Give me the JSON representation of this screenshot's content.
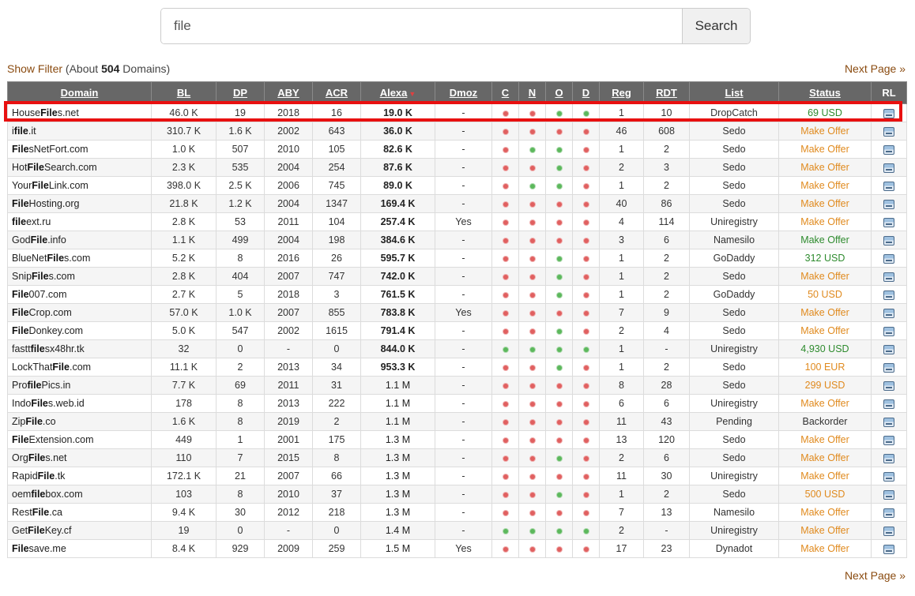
{
  "search": {
    "query": "file",
    "button_label": "Search"
  },
  "filter": {
    "show_filter_label": "Show Filter",
    "about_prefix": " (About ",
    "count": "504",
    "about_suffix": " Domains)"
  },
  "pagination": {
    "next_label": "Next Page »"
  },
  "table": {
    "headers": [
      "Domain",
      "BL",
      "DP",
      "ABY",
      "ACR",
      "Alexa",
      "Dmoz",
      "C",
      "N",
      "O",
      "D",
      "Reg",
      "RDT",
      "List",
      "Status",
      "RL"
    ],
    "sort_indicator": "▼",
    "rows": [
      {
        "pre": "House",
        "kw": "File",
        "post": "s.net",
        "bl": "46.0 K",
        "dp": "19",
        "aby": "2018",
        "acr": "16",
        "alexa": "19.0 K",
        "dmoz": "-",
        "c": "red",
        "n": "red",
        "o": "green",
        "d": "green",
        "reg": "1",
        "rdt": "10",
        "list": "DropCatch",
        "status": "69 USD",
        "status_color": "green"
      },
      {
        "pre": "i",
        "kw": "file",
        "post": ".it",
        "bl": "310.7 K",
        "dp": "1.6 K",
        "aby": "2002",
        "acr": "643",
        "alexa": "36.0 K",
        "dmoz": "-",
        "c": "red",
        "n": "red",
        "o": "red",
        "d": "red",
        "reg": "46",
        "rdt": "608",
        "list": "Sedo",
        "status": "Make Offer",
        "status_color": "orange"
      },
      {
        "pre": "",
        "kw": "File",
        "post": "sNetFort.com",
        "bl": "1.0 K",
        "dp": "507",
        "aby": "2010",
        "acr": "105",
        "alexa": "82.6 K",
        "dmoz": "-",
        "c": "red",
        "n": "green",
        "o": "green",
        "d": "red",
        "reg": "1",
        "rdt": "2",
        "list": "Sedo",
        "status": "Make Offer",
        "status_color": "orange"
      },
      {
        "pre": "Hot",
        "kw": "File",
        "post": "Search.com",
        "bl": "2.3 K",
        "dp": "535",
        "aby": "2004",
        "acr": "254",
        "alexa": "87.6 K",
        "dmoz": "-",
        "c": "red",
        "n": "red",
        "o": "green",
        "d": "red",
        "reg": "2",
        "rdt": "3",
        "list": "Sedo",
        "status": "Make Offer",
        "status_color": "orange"
      },
      {
        "pre": "Your",
        "kw": "File",
        "post": "Link.com",
        "bl": "398.0 K",
        "dp": "2.5 K",
        "aby": "2006",
        "acr": "745",
        "alexa": "89.0 K",
        "dmoz": "-",
        "c": "red",
        "n": "green",
        "o": "green",
        "d": "red",
        "reg": "1",
        "rdt": "2",
        "list": "Sedo",
        "status": "Make Offer",
        "status_color": "orange"
      },
      {
        "pre": "",
        "kw": "File",
        "post": "Hosting.org",
        "bl": "21.8 K",
        "dp": "1.2 K",
        "aby": "2004",
        "acr": "1347",
        "alexa": "169.4 K",
        "dmoz": "-",
        "c": "red",
        "n": "red",
        "o": "red",
        "d": "red",
        "reg": "40",
        "rdt": "86",
        "list": "Sedo",
        "status": "Make Offer",
        "status_color": "orange"
      },
      {
        "pre": "",
        "kw": "file",
        "post": "ext.ru",
        "bl": "2.8 K",
        "dp": "53",
        "aby": "2011",
        "acr": "104",
        "alexa": "257.4 K",
        "dmoz": "Yes",
        "c": "red",
        "n": "red",
        "o": "red",
        "d": "red",
        "reg": "4",
        "rdt": "114",
        "list": "Uniregistry",
        "status": "Make Offer",
        "status_color": "orange"
      },
      {
        "pre": "God",
        "kw": "File",
        "post": ".info",
        "bl": "1.1 K",
        "dp": "499",
        "aby": "2004",
        "acr": "198",
        "alexa": "384.6 K",
        "dmoz": "-",
        "c": "red",
        "n": "red",
        "o": "red",
        "d": "red",
        "reg": "3",
        "rdt": "6",
        "list": "Namesilo",
        "status": "Make Offer",
        "status_color": "green"
      },
      {
        "pre": "BlueNet",
        "kw": "File",
        "post": "s.com",
        "bl": "5.2 K",
        "dp": "8",
        "aby": "2016",
        "acr": "26",
        "alexa": "595.7 K",
        "dmoz": "-",
        "c": "red",
        "n": "red",
        "o": "green",
        "d": "red",
        "reg": "1",
        "rdt": "2",
        "list": "GoDaddy",
        "status": "312 USD",
        "status_color": "green"
      },
      {
        "pre": "Snip",
        "kw": "File",
        "post": "s.com",
        "bl": "2.8 K",
        "dp": "404",
        "aby": "2007",
        "acr": "747",
        "alexa": "742.0 K",
        "dmoz": "-",
        "c": "red",
        "n": "red",
        "o": "green",
        "d": "red",
        "reg": "1",
        "rdt": "2",
        "list": "Sedo",
        "status": "Make Offer",
        "status_color": "orange"
      },
      {
        "pre": "",
        "kw": "File",
        "post": "007.com",
        "bl": "2.7 K",
        "dp": "5",
        "aby": "2018",
        "acr": "3",
        "alexa": "761.5 K",
        "dmoz": "-",
        "c": "red",
        "n": "red",
        "o": "green",
        "d": "red",
        "reg": "1",
        "rdt": "2",
        "list": "GoDaddy",
        "status": "50 USD",
        "status_color": "orange"
      },
      {
        "pre": "",
        "kw": "File",
        "post": "Crop.com",
        "bl": "57.0 K",
        "dp": "1.0 K",
        "aby": "2007",
        "acr": "855",
        "alexa": "783.8 K",
        "dmoz": "Yes",
        "c": "red",
        "n": "red",
        "o": "red",
        "d": "red",
        "reg": "7",
        "rdt": "9",
        "list": "Sedo",
        "status": "Make Offer",
        "status_color": "orange"
      },
      {
        "pre": "",
        "kw": "File",
        "post": "Donkey.com",
        "bl": "5.0 K",
        "dp": "547",
        "aby": "2002",
        "acr": "1615",
        "alexa": "791.4 K",
        "dmoz": "-",
        "c": "red",
        "n": "red",
        "o": "green",
        "d": "red",
        "reg": "2",
        "rdt": "4",
        "list": "Sedo",
        "status": "Make Offer",
        "status_color": "orange"
      },
      {
        "pre": "fastt",
        "kw": "file",
        "post": "sx48hr.tk",
        "bl": "32",
        "dp": "0",
        "aby": "-",
        "acr": "0",
        "alexa": "844.0 K",
        "dmoz": "-",
        "c": "green",
        "n": "green",
        "o": "green",
        "d": "green",
        "reg": "1",
        "rdt": "-",
        "list": "Uniregistry",
        "status": "4,930 USD",
        "status_color": "green"
      },
      {
        "pre": "LockThat",
        "kw": "File",
        "post": ".com",
        "bl": "11.1 K",
        "dp": "2",
        "aby": "2013",
        "acr": "34",
        "alexa": "953.3 K",
        "dmoz": "-",
        "c": "red",
        "n": "red",
        "o": "green",
        "d": "red",
        "reg": "1",
        "rdt": "2",
        "list": "Sedo",
        "status": "100 EUR",
        "status_color": "orange"
      },
      {
        "pre": "Pro",
        "kw": "file",
        "post": "Pics.in",
        "bl": "7.7 K",
        "dp": "69",
        "aby": "2011",
        "acr": "31",
        "alexa": "1.1 M",
        "dmoz": "-",
        "c": "red",
        "n": "red",
        "o": "red",
        "d": "red",
        "reg": "8",
        "rdt": "28",
        "list": "Sedo",
        "status": "299 USD",
        "status_color": "orange"
      },
      {
        "pre": "Indo",
        "kw": "File",
        "post": "s.web.id",
        "bl": "178",
        "dp": "8",
        "aby": "2013",
        "acr": "222",
        "alexa": "1.1 M",
        "dmoz": "-",
        "c": "red",
        "n": "red",
        "o": "red",
        "d": "red",
        "reg": "6",
        "rdt": "6",
        "list": "Uniregistry",
        "status": "Make Offer",
        "status_color": "orange"
      },
      {
        "pre": "Zip",
        "kw": "File",
        "post": ".co",
        "bl": "1.6 K",
        "dp": "8",
        "aby": "2019",
        "acr": "2",
        "alexa": "1.1 M",
        "dmoz": "-",
        "c": "red",
        "n": "red",
        "o": "red",
        "d": "red",
        "reg": "11",
        "rdt": "43",
        "list": "Pending",
        "status": "Backorder",
        "status_color": "dark"
      },
      {
        "pre": "",
        "kw": "File",
        "post": "Extension.com",
        "bl": "449",
        "dp": "1",
        "aby": "2001",
        "acr": "175",
        "alexa": "1.3 M",
        "dmoz": "-",
        "c": "red",
        "n": "red",
        "o": "red",
        "d": "red",
        "reg": "13",
        "rdt": "120",
        "list": "Sedo",
        "status": "Make Offer",
        "status_color": "orange"
      },
      {
        "pre": "Org",
        "kw": "File",
        "post": "s.net",
        "bl": "110",
        "dp": "7",
        "aby": "2015",
        "acr": "8",
        "alexa": "1.3 M",
        "dmoz": "-",
        "c": "red",
        "n": "red",
        "o": "green",
        "d": "red",
        "reg": "2",
        "rdt": "6",
        "list": "Sedo",
        "status": "Make Offer",
        "status_color": "orange"
      },
      {
        "pre": "Rapid",
        "kw": "File",
        "post": ".tk",
        "bl": "172.1 K",
        "dp": "21",
        "aby": "2007",
        "acr": "66",
        "alexa": "1.3 M",
        "dmoz": "-",
        "c": "red",
        "n": "red",
        "o": "red",
        "d": "red",
        "reg": "11",
        "rdt": "30",
        "list": "Uniregistry",
        "status": "Make Offer",
        "status_color": "orange"
      },
      {
        "pre": "oem",
        "kw": "file",
        "post": "box.com",
        "bl": "103",
        "dp": "8",
        "aby": "2010",
        "acr": "37",
        "alexa": "1.3 M",
        "dmoz": "-",
        "c": "red",
        "n": "red",
        "o": "green",
        "d": "red",
        "reg": "1",
        "rdt": "2",
        "list": "Sedo",
        "status": "500 USD",
        "status_color": "orange"
      },
      {
        "pre": "Rest",
        "kw": "File",
        "post": ".ca",
        "bl": "9.4 K",
        "dp": "30",
        "aby": "2012",
        "acr": "218",
        "alexa": "1.3 M",
        "dmoz": "-",
        "c": "red",
        "n": "red",
        "o": "red",
        "d": "red",
        "reg": "7",
        "rdt": "13",
        "list": "Namesilo",
        "status": "Make Offer",
        "status_color": "orange"
      },
      {
        "pre": "Get",
        "kw": "File",
        "post": "Key.cf",
        "bl": "19",
        "dp": "0",
        "aby": "-",
        "acr": "0",
        "alexa": "1.4 M",
        "dmoz": "-",
        "c": "green",
        "n": "green",
        "o": "green",
        "d": "green",
        "reg": "2",
        "rdt": "-",
        "list": "Uniregistry",
        "status": "Make Offer",
        "status_color": "orange"
      },
      {
        "pre": "",
        "kw": "File",
        "post": "save.me",
        "bl": "8.4 K",
        "dp": "929",
        "aby": "2009",
        "acr": "259",
        "alexa": "1.5 M",
        "dmoz": "Yes",
        "c": "red",
        "n": "red",
        "o": "red",
        "d": "red",
        "reg": "17",
        "rdt": "23",
        "list": "Dynadot",
        "status": "Make Offer",
        "status_color": "orange"
      }
    ]
  }
}
